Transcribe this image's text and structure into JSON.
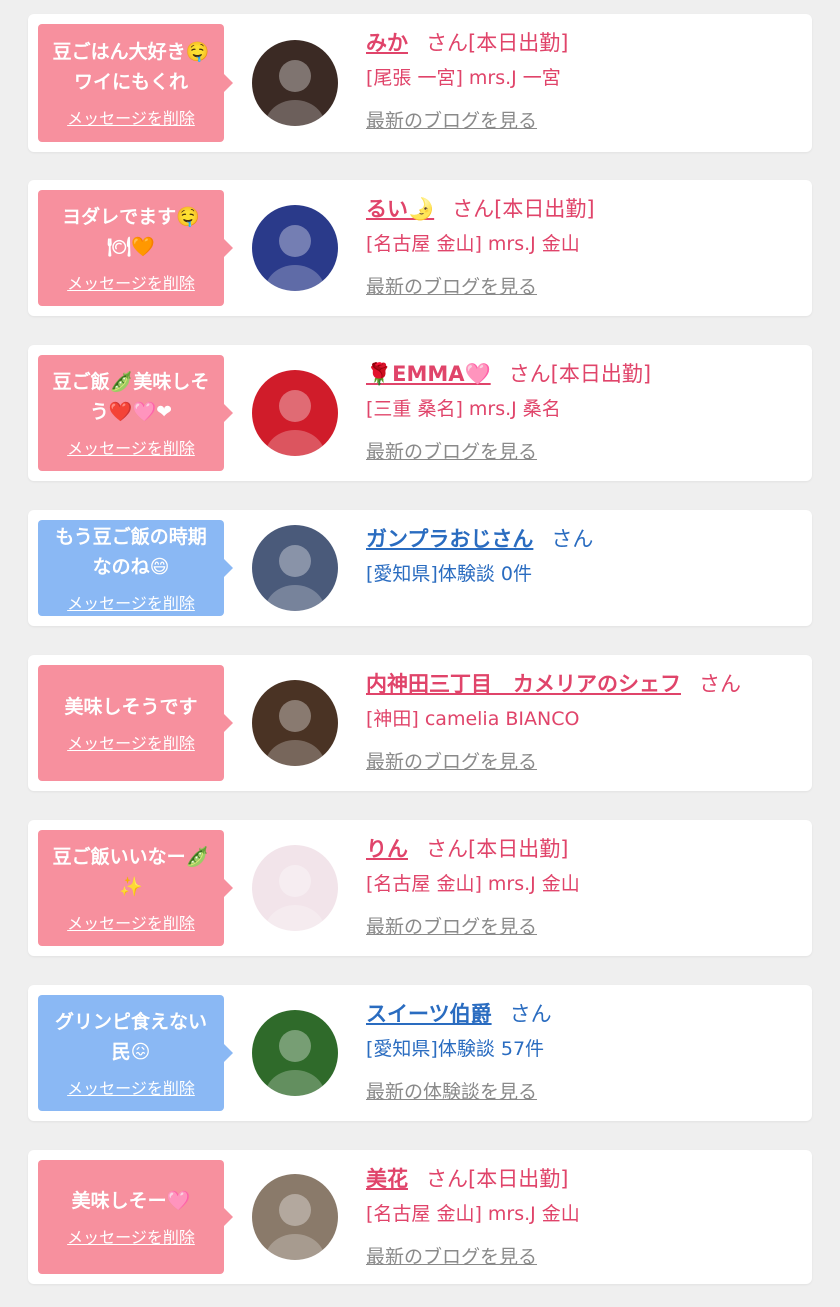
{
  "cards": [
    {
      "theme": "pink",
      "message_line1": "豆ごはん大好き🤤",
      "message_line2": "ワイにもくれ",
      "delete_label": "メッセージを削除",
      "name": "みか",
      "suffix": "さん[本日出勤]",
      "shop": "[尾張 一宮] mrs.J 一宮",
      "link": "最新のブログを見る",
      "avatar_color": "#3b2a24"
    },
    {
      "theme": "pink",
      "message_line1": "ヨダレでます🤤",
      "message_line2": "🍽🧡",
      "delete_label": "メッセージを削除",
      "name": "るい🌛",
      "suffix": "さん[本日出勤]",
      "shop": "[名古屋 金山] mrs.J 金山",
      "link": "最新のブログを見る",
      "avatar_color": "#2a3a8a"
    },
    {
      "theme": "pink",
      "message_line1": "豆ご飯🫛美味しそ",
      "message_line2": "う❤️🩷❤",
      "delete_label": "メッセージを削除",
      "name": "🌹EMMA🩷",
      "suffix": "さん[本日出勤]",
      "shop": "[三重 桑名] mrs.J 桑名",
      "link": "最新のブログを見る",
      "avatar_color": "#d01c2a"
    },
    {
      "theme": "blue",
      "message_line1": "もう豆ご飯の時期",
      "message_line2": "なのね😄",
      "delete_label": "メッセージを削除",
      "name": "ガンプラおじさん",
      "suffix": "さん",
      "shop": "[愛知県]体験談 0件",
      "link": "",
      "avatar_color": "#4a5a7a"
    },
    {
      "theme": "pink",
      "message_line1": "美味しそうです",
      "message_line2": "",
      "delete_label": "メッセージを削除",
      "name": "内神田三丁目　カメリアのシェフ",
      "suffix": "さん",
      "shop": "[神田] camelia BIANCO",
      "link": "最新のブログを見る",
      "avatar_color": "#4a3324"
    },
    {
      "theme": "pink",
      "message_line1": "豆ご飯いいなー🫛",
      "message_line2": "✨",
      "delete_label": "メッセージを削除",
      "name": "りん",
      "suffix": "さん[本日出勤]",
      "shop": "[名古屋 金山] mrs.J 金山",
      "link": "最新のブログを見る",
      "avatar_color": "#f2e4ea"
    },
    {
      "theme": "blue",
      "message_line1": "グリンピ食えない",
      "message_line2": "民😖",
      "delete_label": "メッセージを削除",
      "name": "スイーツ伯爵",
      "suffix": "さん",
      "shop": "[愛知県]体験談 57件",
      "link": "最新の体験談を見る",
      "avatar_color": "#2f6a2a"
    },
    {
      "theme": "pink",
      "message_line1": "美味しそー🩷",
      "message_line2": "",
      "delete_label": "メッセージを削除",
      "name": "美花",
      "suffix": "さん[本日出勤]",
      "shop": "[名古屋 金山] mrs.J 金山",
      "link": "最新のブログを見る",
      "avatar_color": "#8a7a6a"
    }
  ]
}
